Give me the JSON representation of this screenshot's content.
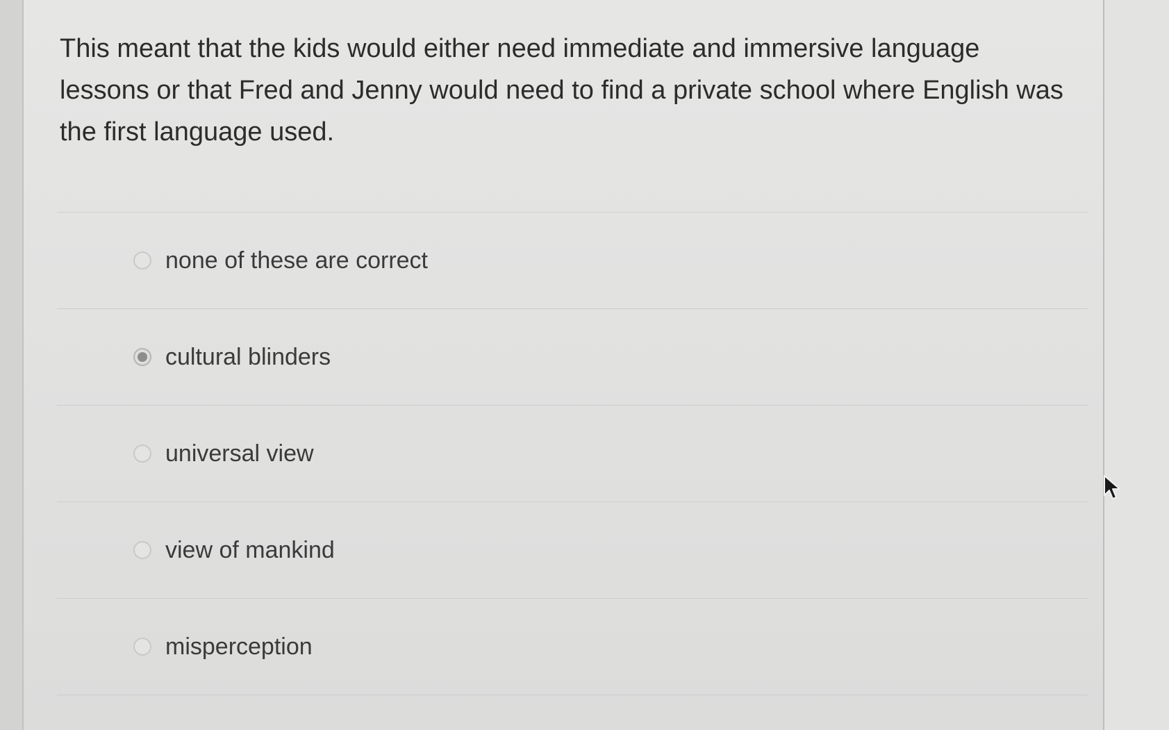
{
  "question": {
    "text": "This meant that the kids would either need immediate and immersive language lessons or that Fred and Jenny would need to find a private school where English was the first language used."
  },
  "options": [
    {
      "label": "none of these are correct",
      "selected": false
    },
    {
      "label": "cultural blinders",
      "selected": true
    },
    {
      "label": "universal view",
      "selected": false
    },
    {
      "label": "view of mankind",
      "selected": false
    },
    {
      "label": "misperception",
      "selected": false
    }
  ],
  "icons": {
    "cursor": "mouse-pointer-icon",
    "radio": "radio-button-icon"
  },
  "colors": {
    "text": "#2c2c2c",
    "radio_border": "#c9c9c8",
    "radio_selected_dot": "#8d8d8c"
  }
}
